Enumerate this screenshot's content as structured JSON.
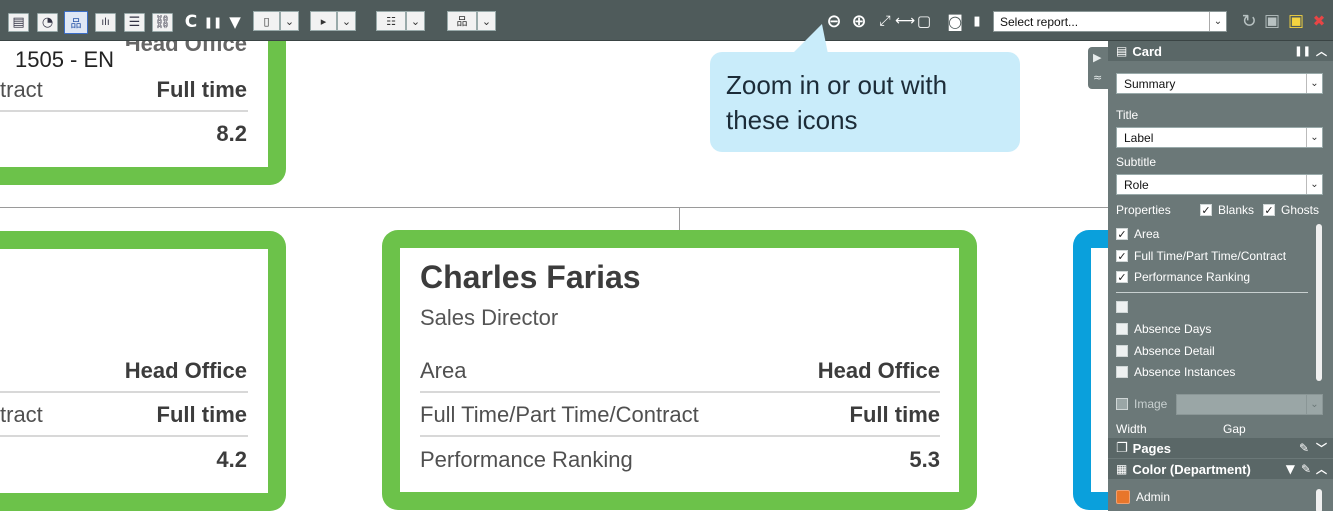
{
  "toolbar": {
    "report_select": {
      "value": "Select report..."
    },
    "dropdown_glyph": "⌄",
    "icons": {
      "table": "▤",
      "dashboard": "◔",
      "orgchart": "品",
      "bar_chart": "ılı",
      "list": "☰",
      "link": "⛓",
      "refresh": "C",
      "pause": "❚❚",
      "filter": "▼",
      "bookmark": "▯",
      "play": "▸",
      "indent": "☷",
      "hierarchy": "品",
      "zoom_out": "⊖",
      "zoom_in": "⊕",
      "fit_expand": "⤢",
      "fit_width": "⟷",
      "fit_frame": "▢",
      "camera": "◙",
      "pin": "▮",
      "sync": "↻",
      "save_as": "▣",
      "save": "▣",
      "close": "✖"
    }
  },
  "tooltip": {
    "text_line1": "Zoom in or out with",
    "text_line2": "these icons"
  },
  "chip_1505": "1505 - EN",
  "cards": {
    "top_left": {
      "partial_title": "Head Office",
      "rows": [
        {
          "label": "tract",
          "value": "Full time"
        },
        {
          "label": "",
          "value": "8.2"
        }
      ]
    },
    "mid_left": {
      "rows": [
        {
          "label": "",
          "value": "Head Office"
        },
        {
          "label": "tract",
          "value": "Full time"
        },
        {
          "label": "",
          "value": "4.2"
        }
      ]
    },
    "center": {
      "name": "Charles Farias",
      "role": "Sales Director",
      "rows": [
        {
          "label": "Area",
          "value": "Head Office"
        },
        {
          "label": "Full Time/Part Time/Contract",
          "value": "Full time"
        },
        {
          "label": "Performance Ranking",
          "value": "5.3"
        }
      ]
    }
  },
  "colors": {
    "card_green": "#6cc24a",
    "card_blue": "#0aa0dc",
    "tooltip_bg": "#c9ecfa",
    "toolbar_bg": "#4f5b5b",
    "sidebar_bg": "#6b7878"
  },
  "sidebar": {
    "collapse_tab": {
      "expand_glyph": "▶",
      "up_glyph": "≈"
    },
    "card_section": {
      "title": "Card",
      "pause_glyph": "❚❚",
      "chevron_glyph": "︿",
      "summary_select": "Summary",
      "title_label": "Title",
      "title_select": "Label",
      "subtitle_label": "Subtitle",
      "subtitle_select": "Role",
      "properties_label": "Properties",
      "blanks_label": "Blanks",
      "ghosts_label": "Ghosts",
      "checked_items": [
        "Area",
        "Full Time/Part Time/Contract",
        "Performance Ranking"
      ],
      "unchecked_items": [
        "",
        "Absence Days",
        "Absence Detail",
        "Absence Instances"
      ],
      "image_label": "Image",
      "width_label": "Width",
      "gap_label": "Gap"
    },
    "pages_section": {
      "title": "Pages"
    },
    "color_section": {
      "title": "Color (Department)",
      "items": [
        {
          "label": "Admin",
          "color": "#e8762b"
        }
      ]
    },
    "check_glyph": "✓"
  }
}
